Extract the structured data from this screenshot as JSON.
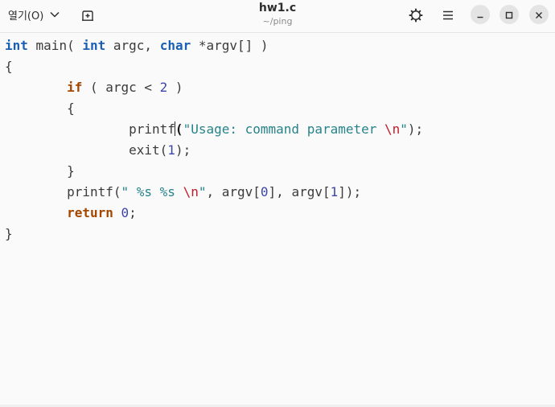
{
  "header": {
    "open_label": "열기(O)",
    "title": "hw1.c",
    "subtitle": "~/ping",
    "icons": {
      "open_dropdown": "chevron-down-icon",
      "new_tab": "new-tab-icon",
      "spellcheck": "settings-gear-icon",
      "menu": "hamburger-menu-icon",
      "minimize": "minimize-icon",
      "maximize": "maximize-icon",
      "close": "close-icon"
    }
  },
  "code": {
    "l1": {
      "kt1": "int",
      "t1": " main( ",
      "kt2": "int",
      "t2": " argc, ",
      "kt3": "char",
      "t3": " *argv[] )"
    },
    "l2": {
      "t": "{"
    },
    "l3": {
      "ind": "        ",
      "kw": "if",
      "t1": " ( argc < ",
      "num": "2",
      "t2": " )"
    },
    "l4": {
      "ind": "        ",
      "t": "{"
    },
    "l5": {
      "ind": "                ",
      "fn": "printf",
      "paren": "(",
      "s1": "\"Usage: command parameter ",
      "esc": "\\n",
      "s2": "\"",
      "t": ");"
    },
    "l6": {
      "ind": "                ",
      "t1": "exit(",
      "num": "1",
      "t2": ");"
    },
    "l7": {
      "ind": "        ",
      "t": "}"
    },
    "l8": {
      "ind": "        ",
      "t1": "printf(",
      "s1": "\" %s %s ",
      "esc": "\\n",
      "s2": "\"",
      "t2": ", argv[",
      "n1": "0",
      "t3": "], argv[",
      "n2": "1",
      "t4": "]);"
    },
    "l9": {
      "ind": "        ",
      "kw": "return",
      "t1": " ",
      "num": "0",
      "t2": ";"
    },
    "l10": {
      "t": "}"
    }
  },
  "colors": {
    "keyword": "#a34700",
    "type": "#1a5fb4",
    "string": "#26838a",
    "escape": "#c01c28",
    "number": "#3d46a8",
    "background": "#fafafa"
  }
}
